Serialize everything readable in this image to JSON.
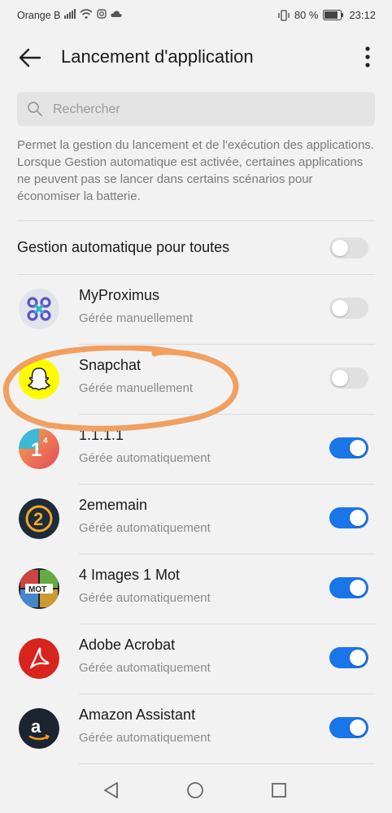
{
  "status_bar": {
    "carrier": "Orange B",
    "battery": "80 %",
    "time": "23:12"
  },
  "header": {
    "title": "Lancement d'application"
  },
  "search": {
    "placeholder": "Rechercher"
  },
  "description": "Permet la gestion du lancement et de l'exécution des applications. Lorsque Gestion automatique est activée, certaines applications ne peuvent pas se lancer dans certains scénarios pour économiser la batterie.",
  "global_toggle": {
    "label": "Gestion automatique pour toutes",
    "on": false
  },
  "apps": [
    {
      "name": "MyProximus",
      "status": "Gérée manuellement",
      "on": false,
      "icon": "myproximus-icon"
    },
    {
      "name": "Snapchat",
      "status": "Gérée manuellement",
      "on": false,
      "icon": "snapchat-icon"
    },
    {
      "name": "1.1.1.1",
      "status": "Gérée automatiquement",
      "on": true,
      "icon": "one-one-one-one-icon"
    },
    {
      "name": "2ememain",
      "status": "Gérée automatiquement",
      "on": true,
      "icon": "2ememain-icon"
    },
    {
      "name": "4 Images 1 Mot",
      "status": "Gérée automatiquement",
      "on": true,
      "icon": "4-images-1-mot-icon"
    },
    {
      "name": "Adobe Acrobat",
      "status": "Gérée automatiquement",
      "on": true,
      "icon": "adobe-acrobat-icon"
    },
    {
      "name": "Amazon Assistant",
      "status": "Gérée automatiquement",
      "on": true,
      "icon": "amazon-assistant-icon"
    }
  ],
  "colors": {
    "accent": "#1a75e8",
    "highlight_stroke": "#f0a060"
  }
}
